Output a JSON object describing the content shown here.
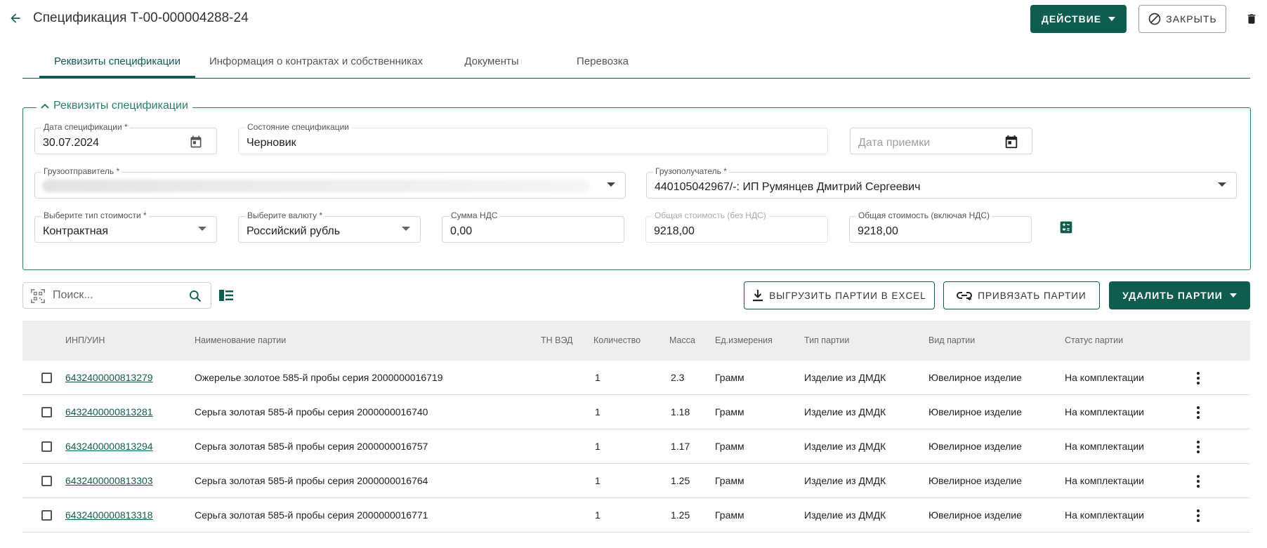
{
  "header": {
    "title": "Спецификация Т-00-000004288-24",
    "action_label": "ДЕЙСТВИЕ",
    "close_label": "ЗАКРЫТЬ"
  },
  "tabs": [
    {
      "label": "Реквизиты спецификации",
      "active": true
    },
    {
      "label": "Информация о контрактах и собственниках",
      "active": false
    },
    {
      "label": "Документы",
      "active": false
    },
    {
      "label": "Перевозка",
      "active": false
    }
  ],
  "section": {
    "legend": "Реквизиты спецификации",
    "fields": {
      "spec_date": {
        "label": "Дата спецификации *",
        "value": "30.07.2024"
      },
      "spec_state": {
        "label": "Состояние спецификации",
        "value": "Черновик"
      },
      "accept_date": {
        "placeholder": "Дата приемки"
      },
      "shipper": {
        "label": "Грузоотправитель *",
        "value": ""
      },
      "consignee": {
        "label": "Грузополучатель *",
        "value": "440105042967/-: ИП Румянцев Дмитрий Сергеевич"
      },
      "cost_type": {
        "label": "Выберите тип стоимости *",
        "value": "Контрактная"
      },
      "currency": {
        "label": "Выберите валюту *",
        "value": "Российский рубль"
      },
      "vat_sum": {
        "label": "Сумма НДС",
        "value": "0,00"
      },
      "total_no_vat": {
        "label": "Общая стоимость (без НДС)",
        "value": "9218,00"
      },
      "total_with_vat": {
        "label": "Общая стоимость (включая НДС)",
        "value": "9218,00"
      }
    }
  },
  "toolbar": {
    "search_placeholder": "Поиск...",
    "export_label": "ВЫГРУЗИТЬ ПАРТИИ В EXCEL",
    "link_label": "ПРИВЯЗАТЬ ПАРТИИ",
    "delete_label": "УДАЛИТЬ ПАРТИИ"
  },
  "table": {
    "columns": [
      "ИНП/УИН",
      "Наименование партии",
      "ТН ВЭД",
      "Количество",
      "Масса",
      "Ед.измерения",
      "Тип партии",
      "Вид партии",
      "Статус партии"
    ],
    "rows": [
      {
        "inp": "6432400000813279",
        "name": "Ожерелье золотое 585-й пробы серия 2000000016719",
        "tnved": "",
        "qty": "1",
        "mass": "2.3",
        "unit": "Грамм",
        "type": "Изделие из ДМДК",
        "kind": "Ювелирное изделие",
        "status": "На комплектации"
      },
      {
        "inp": "6432400000813281",
        "name": "Серьга золотая 585-й пробы серия 2000000016740",
        "tnved": "",
        "qty": "1",
        "mass": "1.18",
        "unit": "Грамм",
        "type": "Изделие из ДМДК",
        "kind": "Ювелирное изделие",
        "status": "На комплектации"
      },
      {
        "inp": "6432400000813294",
        "name": "Серьга золотая 585-й пробы серия 2000000016757",
        "tnved": "",
        "qty": "1",
        "mass": "1.17",
        "unit": "Грамм",
        "type": "Изделие из ДМДК",
        "kind": "Ювелирное изделие",
        "status": "На комплектации"
      },
      {
        "inp": "6432400000813303",
        "name": "Серьга золотая 585-й пробы серия 2000000016764",
        "tnved": "",
        "qty": "1",
        "mass": "1.25",
        "unit": "Грамм",
        "type": "Изделие из ДМДК",
        "kind": "Ювелирное изделие",
        "status": "На комплектации"
      },
      {
        "inp": "6432400000813318",
        "name": "Серьга золотая 585-й пробы серия 2000000016771",
        "tnved": "",
        "qty": "1",
        "mass": "1.25",
        "unit": "Грамм",
        "type": "Изделие из ДМДК",
        "kind": "Ювелирное изделие",
        "status": "На комплектации"
      }
    ]
  },
  "colors": {
    "accent": "#0f5d4f",
    "border_accent": "#2e7d6b"
  },
  "icons": [
    "arrow-left-icon",
    "caret-down-icon",
    "block-icon",
    "trash-icon",
    "chevron-up-icon",
    "calendar-icon",
    "calculator-icon",
    "qr-scan-icon",
    "search-icon",
    "columns-icon",
    "download-icon",
    "link-icon",
    "kebab-icon"
  ]
}
